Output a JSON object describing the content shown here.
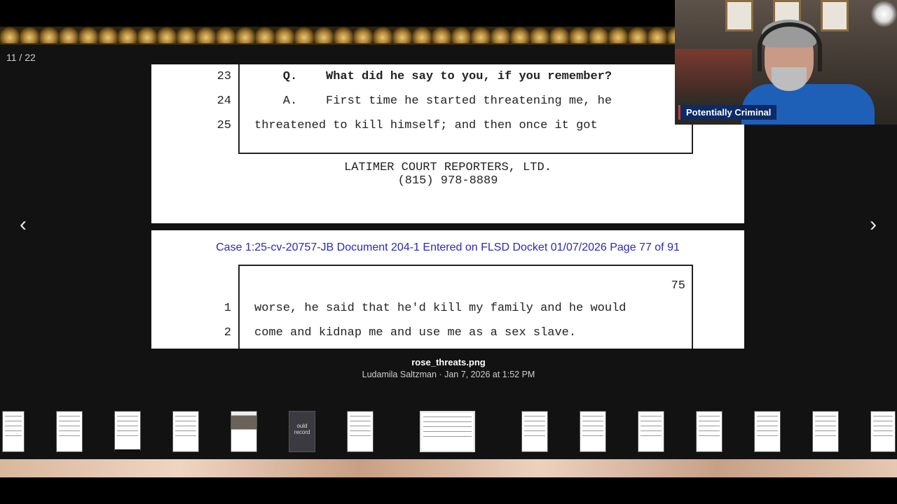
{
  "viewer": {
    "counter": "11 / 22",
    "prev_icon": "chevron-left-icon",
    "next_icon": "chevron-right-icon",
    "file_name": "rose_threats.png",
    "meta": "Ludamila Saltzman · Jan 7, 2026 at 1:52 PM"
  },
  "document": {
    "top_page": {
      "lines": [
        {
          "num": "23",
          "text": "    Q.    What did he say to you, if you remember?",
          "bold": true
        },
        {
          "num": "24",
          "text": "    A.    First time he started threatening me, he",
          "bold": false
        },
        {
          "num": "25",
          "text": "threatened to kill himself; and then once it got",
          "bold": false
        }
      ],
      "reporter_name": "LATIMER COURT REPORTERS, LTD.",
      "reporter_phone": "(815) 978-8889"
    },
    "bottom_page": {
      "header": "Case 1:25-cv-20757-JB   Document 204-1   Entered on FLSD Docket 01/07/2026   Page 77 of 91",
      "page_number": "75",
      "lines": [
        {
          "num": "1",
          "text": "worse, he said that he'd kill my family and he would"
        },
        {
          "num": "2",
          "text": "come and kidnap me and use me as a sex slave."
        }
      ]
    }
  },
  "thumbnails": {
    "partial_text": "ould record"
  },
  "webcam": {
    "label": "Potentially Criminal",
    "accent_color": "#0b2a66"
  }
}
